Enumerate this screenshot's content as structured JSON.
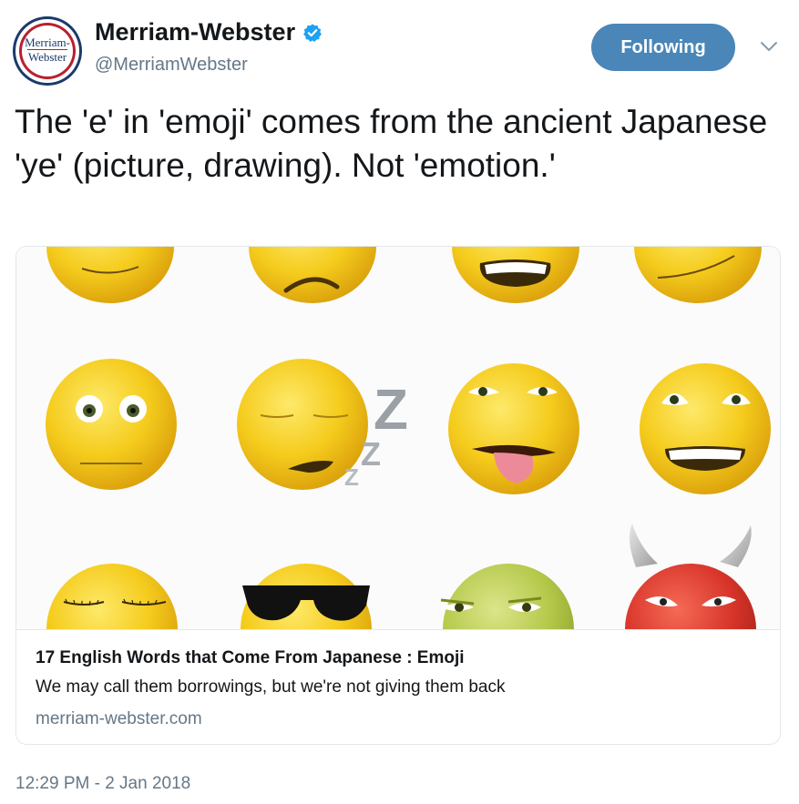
{
  "author": {
    "name": "Merriam-Webster",
    "handle": "@MerriamWebster",
    "avatar_text_line1": "Merriam-",
    "avatar_text_line2": "Webster",
    "verified_icon": "verified-badge-icon"
  },
  "actions": {
    "follow_label": "Following",
    "menu_icon": "chevron-down-icon"
  },
  "tweet": {
    "text": "The 'e' in 'emoji' comes from the ancient Japanese 'ye' (picture, drawing). Not 'emotion.'",
    "timestamp": "12:29 PM - 2 Jan 2018"
  },
  "card": {
    "image_description_icon": "emoji-faces-image",
    "title": "17 English Words that Come From Japanese : Emoji",
    "description": "We may call them borrowings, but we're not giving them back",
    "domain": "merriam-webster.com"
  },
  "colors": {
    "accent": "#4a86b8",
    "muted": "#657786",
    "text": "#14171a",
    "emoji_yellow": "#f2c511",
    "emoji_green": "#b5c84a",
    "devil_red": "#d8352a"
  }
}
